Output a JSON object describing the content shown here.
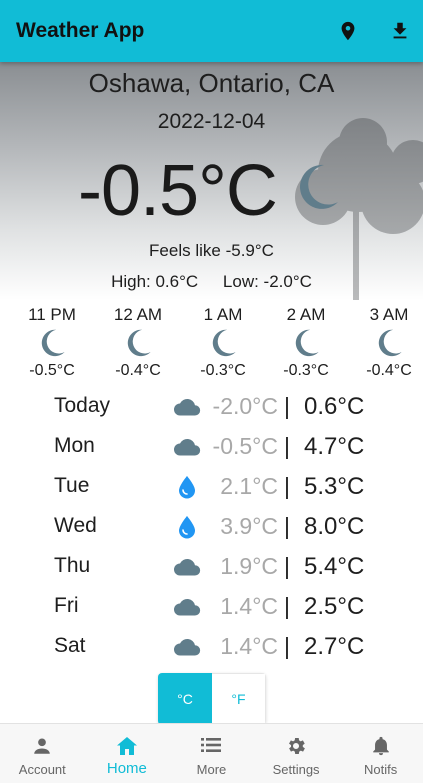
{
  "app": {
    "title": "Weather App"
  },
  "toolbar": {
    "location_icon": "location-pin-icon",
    "download_icon": "download-icon"
  },
  "current": {
    "location": "Oshawa, Ontario, CA",
    "date": "2022-12-04",
    "temperature": "-0.5°C",
    "condition_icon": "moon-icon",
    "feels_like": "Feels like -5.9°C",
    "high": "High: 0.6°C",
    "low": "Low: -2.0°C"
  },
  "hourly": [
    {
      "time": "11 PM",
      "icon": "moon-icon",
      "temp": "-0.5°C"
    },
    {
      "time": "12 AM",
      "icon": "moon-icon",
      "temp": "-0.4°C"
    },
    {
      "time": "1 AM",
      "icon": "moon-icon",
      "temp": "-0.3°C"
    },
    {
      "time": "2 AM",
      "icon": "moon-icon",
      "temp": "-0.3°C"
    },
    {
      "time": "3 AM",
      "icon": "moon-icon",
      "temp": "-0.4°C"
    }
  ],
  "daily": [
    {
      "day": "Today",
      "icon": "cloud-icon",
      "low": "-2.0°C",
      "sep": "|",
      "high": "0.6°C"
    },
    {
      "day": "Mon",
      "icon": "cloud-icon",
      "low": "-0.5°C",
      "sep": "|",
      "high": "4.7°C"
    },
    {
      "day": "Tue",
      "icon": "rain-drop-icon",
      "low": "2.1°C",
      "sep": "|",
      "high": "5.3°C"
    },
    {
      "day": "Wed",
      "icon": "rain-drop-icon",
      "low": "3.9°C",
      "sep": "|",
      "high": "8.0°C"
    },
    {
      "day": "Thu",
      "icon": "cloud-icon",
      "low": "1.9°C",
      "sep": "|",
      "high": "5.4°C"
    },
    {
      "day": "Fri",
      "icon": "cloud-icon",
      "low": "1.4°C",
      "sep": "|",
      "high": "2.5°C"
    },
    {
      "day": "Sat",
      "icon": "cloud-icon",
      "low": "1.4°C",
      "sep": "|",
      "high": "2.7°C"
    }
  ],
  "units": {
    "celsius": "°C",
    "fahrenheit": "°F",
    "selected": "celsius"
  },
  "nav": [
    {
      "label": "Account",
      "icon": "account-icon",
      "active": false
    },
    {
      "label": "Home",
      "icon": "home-icon",
      "active": true
    },
    {
      "label": "More",
      "icon": "list-icon",
      "active": false
    },
    {
      "label": "Settings",
      "icon": "gear-icon",
      "active": false
    },
    {
      "label": "Notifs",
      "icon": "bell-icon",
      "active": false
    }
  ],
  "colors": {
    "accent": "#11bcd6",
    "icon_gray": "#607d8b",
    "rain_blue": "#2196f3",
    "low_temp_text": "#a8a8a8"
  }
}
